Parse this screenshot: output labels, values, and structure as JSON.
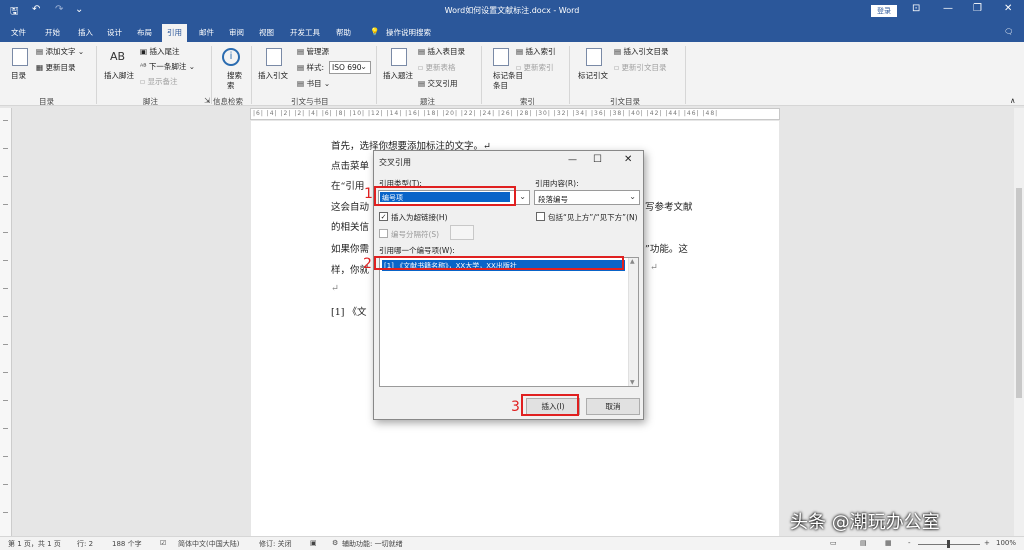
{
  "titlebar": {
    "title": "Word如何设置文献标注.docx - Word",
    "login": "登录",
    "quick_access": {
      "save": "🖫",
      "undo": "↶",
      "redo": "↷",
      "more": "⌄"
    },
    "window_controls": {
      "ribbon_display": "⊡",
      "minimize": "—",
      "restore": "❐",
      "close": "✕"
    }
  },
  "tabs": [
    "文件",
    "开始",
    "插入",
    "设计",
    "布局",
    "引用",
    "邮件",
    "审阅",
    "视图",
    "开发工具",
    "帮助",
    "操作说明搜索"
  ],
  "ribbon": {
    "toc": {
      "toc_label": "目录",
      "add_text": "添加文字",
      "update_toc": "更新目录",
      "group": "目录"
    },
    "footnotes": {
      "insert_footnote": "插入脚注",
      "insert_endnote": "插入尾注",
      "next_footnote": "下一条脚注",
      "show_notes": "显示备注",
      "group": "脚注",
      "icon_text": "AB"
    },
    "research": {
      "search": "搜索",
      "search2": "索",
      "group": "信息检索"
    },
    "citations": {
      "insert_citation": "插入引文",
      "manage_sources": "管理源",
      "style_label": "样式:",
      "style_value": "ISO 690",
      "bibliography": "书目",
      "group": "引文与书目"
    },
    "captions": {
      "insert_caption": "插入题注",
      "insert_table_of_figures": "插入表目录",
      "update_table": "更新表格",
      "cross_reference": "交叉引用",
      "group": "题注"
    },
    "index": {
      "mark_entry": "标记条目",
      "mark_entry2": "条目",
      "insert_index": "插入索引",
      "update_index": "更新索引",
      "group": "索引"
    },
    "toa": {
      "mark_citation": "标记引文",
      "insert_toa": "插入引文目录",
      "update_toa": "更新引文目录",
      "group": "引文目录"
    }
  },
  "ruler": "|6| |4| |2| |2| |4| |6| |8| |10| |12| |14| |16| |18| |20| |22| |24| |26| |28| |30| |32| |34| |36| |38| |40| |42| |44| |46| |48|",
  "document": {
    "lines": [
      "首先，选择你想要添加标注的文字。↵",
      "点击菜单",
      "在“引用",
      "这会自动",
      "的相关信",
      "如果你需",
      "样，你就",
      "↵",
      "[1]  《文"
    ],
    "right_fragments": [
      "写参考文献",
      "”功能。这",
      "↵"
    ]
  },
  "dialog": {
    "title": "交叉引用",
    "minimize": "—",
    "maximize": "☐",
    "close": "✕",
    "ref_type_label": "引用类型(T):",
    "ref_type_value": "编号项",
    "ref_content_label": "引用内容(R):",
    "ref_content_value": "段落编号",
    "insert_hyperlink_label": "插入为超链接(H)",
    "include_above_below_label": "包括“见上方”/“见下方”(N)",
    "separate_numbers_label": "编号分隔符(S)",
    "which_item_label": "引用哪一个编号项(W):",
    "list_items": [
      "[1] 《文献书籍名称》，XX大学，XX出版社"
    ],
    "insert_button": "插入(I)",
    "cancel_button": "取消",
    "check_mark": "✓"
  },
  "annotations": {
    "step1": "1",
    "step2": "2",
    "step3": "3"
  },
  "statusbar": {
    "page": "第 1 页，共 1 页",
    "row": "行: 2",
    "chars": "188 个字",
    "language": "简体中文(中国大陆)",
    "revisions": "修订: 关闭",
    "accessibility": "辅助功能: 一切就绪",
    "zoom": "100%",
    "zoom_minus": "-",
    "zoom_plus": "+"
  },
  "watermark": "头条 @潮玩办公室"
}
